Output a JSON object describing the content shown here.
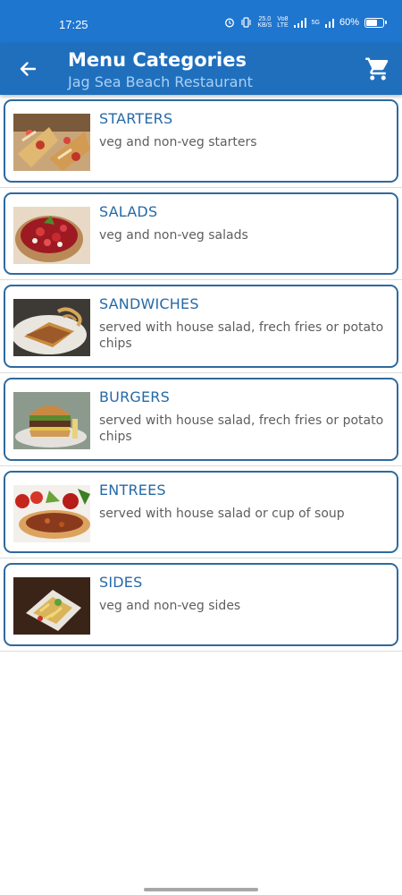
{
  "status_bar": {
    "time": "17:25",
    "speed": "25.0",
    "speed_unit": "KB/S",
    "volte": "Vo8\nLTE",
    "network": "5G",
    "battery": "60%"
  },
  "app_bar": {
    "title": "Menu Categories",
    "subtitle": "Jag Sea Beach Restaurant"
  },
  "categories": [
    {
      "name": "STARTERS",
      "description": "veg and non-veg starters",
      "image": "starters-photo"
    },
    {
      "name": "SALADS",
      "description": "veg and non-veg salads",
      "image": "salads-photo"
    },
    {
      "name": "SANDWICHES",
      "description": "served with house salad, frech fries or potato chips",
      "image": "sandwiches-photo"
    },
    {
      "name": "BURGERS",
      "description": "served with house salad, frech fries or potato chips",
      "image": "burgers-photo"
    },
    {
      "name": "ENTREES",
      "description": "served with house salad or cup of soup",
      "image": "entrees-photo"
    },
    {
      "name": "SIDES",
      "description": "veg and non-veg sides",
      "image": "sides-photo"
    }
  ],
  "colors": {
    "status_bar": "#1f76cf",
    "app_bar": "#1f6fbd",
    "card_border": "#2e6a9e",
    "category_title": "#2569a7",
    "description": "#5e5e5e"
  }
}
